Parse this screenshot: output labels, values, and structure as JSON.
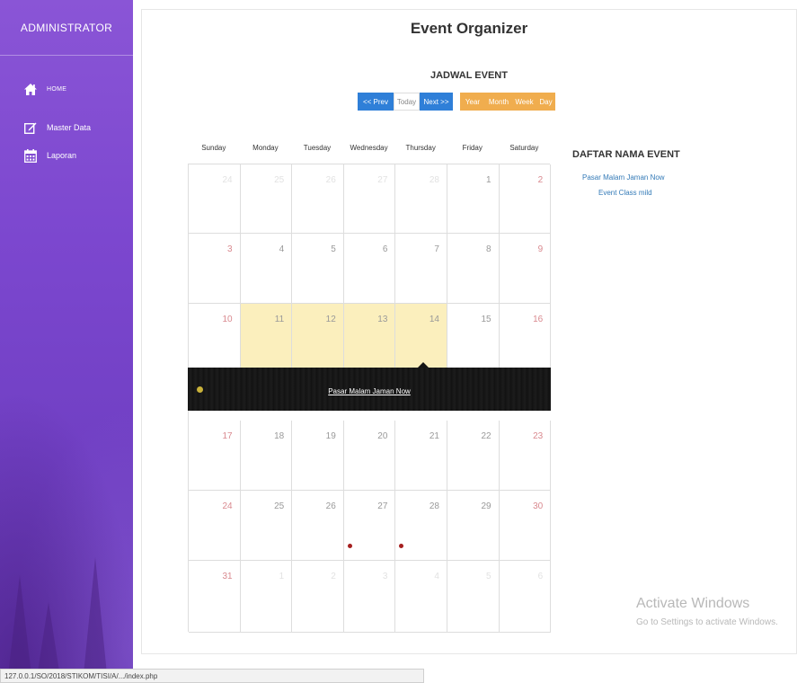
{
  "sidebar": {
    "title": "ADMINISTRATOR",
    "items": [
      {
        "label": "HOME",
        "icon": "home-icon"
      },
      {
        "label": "Master Data",
        "icon": "edit-icon"
      },
      {
        "label": "Laporan",
        "icon": "calendar-icon"
      }
    ]
  },
  "header": {
    "title": "Event Organizer"
  },
  "calendar": {
    "title": "JADWAL EVENT",
    "nav": {
      "prev": "<< Prev",
      "today": "Today",
      "next": "Next >>"
    },
    "views": {
      "year": "Year",
      "month": "Month",
      "week": "Week",
      "day": "Day"
    },
    "weekdays": [
      "Sunday",
      "Monday",
      "Tuesday",
      "Wednesday",
      "Thursday",
      "Friday",
      "Saturday"
    ],
    "weeks": [
      [
        "24",
        "25",
        "26",
        "27",
        "28",
        "1",
        "2"
      ],
      [
        "3",
        "4",
        "5",
        "6",
        "7",
        "8",
        "9"
      ],
      [
        "10",
        "11",
        "12",
        "13",
        "14",
        "15",
        "16"
      ],
      [
        "17",
        "18",
        "19",
        "20",
        "21",
        "22",
        "23"
      ],
      [
        "24",
        "25",
        "26",
        "27",
        "28",
        "29",
        "30"
      ],
      [
        "31",
        "1",
        "2",
        "3",
        "4",
        "5",
        "6"
      ]
    ],
    "open_event": "Pasar Malam Jaman Now",
    "colors": {
      "event_gold": "#c9b23a",
      "event_red": "#a51f1f",
      "highlight": "#fbefbd"
    }
  },
  "event_list": {
    "title": "DAFTAR NAMA EVENT",
    "items": [
      "Pasar Malam Jaman Now",
      "Event Class mild"
    ]
  },
  "watermark": {
    "line1": "Activate Windows",
    "line2": "Go to Settings to activate Windows."
  },
  "status_bar": {
    "url": "127.0.0.1/SO/2018/STIKOM/TISI/A/.../index.php"
  }
}
